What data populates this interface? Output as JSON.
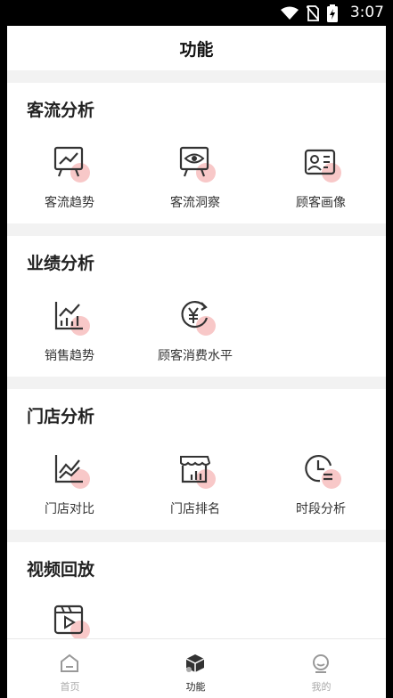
{
  "status_bar": {
    "time": "3:07",
    "icons": [
      "wifi-icon",
      "no-sim-icon",
      "battery-charging-icon"
    ]
  },
  "header": {
    "title": "功能"
  },
  "sections": [
    {
      "title": "客流分析",
      "items": [
        {
          "label": "客流趋势",
          "icon": "trend-board-icon"
        },
        {
          "label": "客流洞察",
          "icon": "eye-board-icon"
        },
        {
          "label": "顾客画像",
          "icon": "profile-card-icon"
        }
      ]
    },
    {
      "title": "业绩分析",
      "items": [
        {
          "label": "销售趋势",
          "icon": "sales-chart-icon"
        },
        {
          "label": "顾客消费水平",
          "icon": "yen-cycle-icon"
        }
      ]
    },
    {
      "title": "门店分析",
      "items": [
        {
          "label": "门店对比",
          "icon": "compare-chart-icon"
        },
        {
          "label": "门店排名",
          "icon": "store-rank-icon"
        },
        {
          "label": "时段分析",
          "icon": "clock-list-icon"
        }
      ]
    },
    {
      "title": "视频回放",
      "items": [
        {
          "label": "",
          "icon": "video-play-icon"
        }
      ]
    }
  ],
  "tabbar": [
    {
      "label": "首页",
      "icon": "home-icon",
      "active": false
    },
    {
      "label": "功能",
      "icon": "cube-icon",
      "active": true
    },
    {
      "label": "我的",
      "icon": "user-face-icon",
      "active": false
    }
  ],
  "colors": {
    "accent_dot": "#f8c8c8",
    "icon_stroke": "#333333",
    "page_bg": "#f2f2f2"
  }
}
